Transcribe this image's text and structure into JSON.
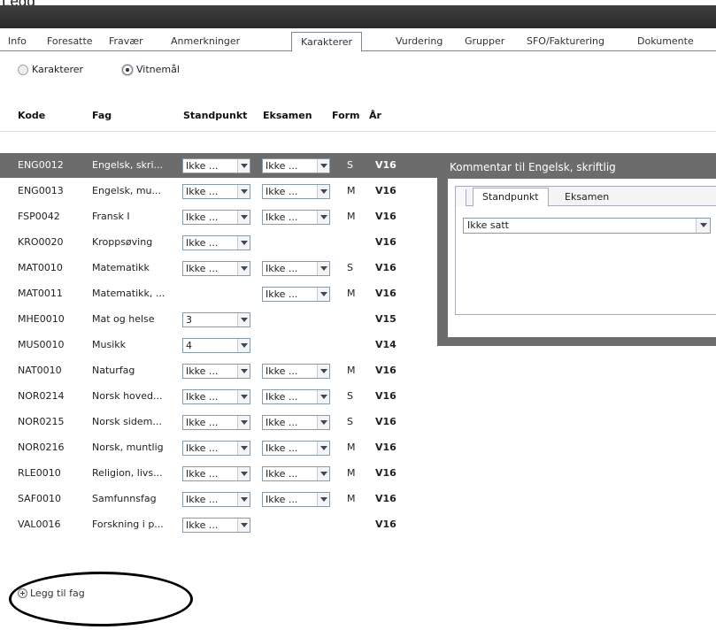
{
  "title_fragment": "Legg",
  "tabs": [
    {
      "label": "Info",
      "active": false
    },
    {
      "label": "Foresatte",
      "active": false
    },
    {
      "label": "Fravær",
      "active": false
    },
    {
      "label": "Anmerkninger",
      "active": false
    },
    {
      "label": "Karakterer",
      "active": true
    },
    {
      "label": "Vurdering",
      "active": false
    },
    {
      "label": "Grupper",
      "active": false
    },
    {
      "label": "SFO/Fakturering",
      "active": false
    },
    {
      "label": "Dokumente",
      "active": false
    }
  ],
  "mode": {
    "options": [
      {
        "label": "Karakterer",
        "checked": false
      },
      {
        "label": "Vitnemål",
        "checked": true
      }
    ]
  },
  "table": {
    "columns": [
      "Kode",
      "Fag",
      "Standpunkt",
      "Eksamen",
      "Form",
      "År"
    ],
    "rows": [
      {
        "kode": "ENG0012",
        "fag": "Engelsk, skri...",
        "standpunkt": "Ikke ...",
        "eksamen": "Ikke ...",
        "form": "S",
        "ar": "V16",
        "selected": true
      },
      {
        "kode": "ENG0013",
        "fag": "Engelsk, mu...",
        "standpunkt": "Ikke ...",
        "eksamen": "Ikke ...",
        "form": "M",
        "ar": "V16"
      },
      {
        "kode": "FSP0042",
        "fag": "Fransk I",
        "standpunkt": "Ikke ...",
        "eksamen": "Ikke ...",
        "form": "M",
        "ar": "V16"
      },
      {
        "kode": "KRO0020",
        "fag": "Kroppsøving",
        "standpunkt": "Ikke ...",
        "eksamen": "",
        "form": "",
        "ar": "V16"
      },
      {
        "kode": "MAT0010",
        "fag": "Matematikk",
        "standpunkt": "Ikke ...",
        "eksamen": "Ikke ...",
        "form": "S",
        "ar": "V16"
      },
      {
        "kode": "MAT0011",
        "fag": "Matematikk, ...",
        "standpunkt": "",
        "eksamen": "Ikke ...",
        "form": "M",
        "ar": "V16"
      },
      {
        "kode": "MHE0010",
        "fag": "Mat og helse",
        "standpunkt": "3",
        "eksamen": "",
        "form": "",
        "ar": "V15"
      },
      {
        "kode": "MUS0010",
        "fag": "Musikk",
        "standpunkt": "4",
        "eksamen": "",
        "form": "",
        "ar": "V14"
      },
      {
        "kode": "NAT0010",
        "fag": "Naturfag",
        "standpunkt": "Ikke ...",
        "eksamen": "Ikke ...",
        "form": "M",
        "ar": "V16"
      },
      {
        "kode": "NOR0214",
        "fag": "Norsk hoved...",
        "standpunkt": "Ikke ...",
        "eksamen": "Ikke ...",
        "form": "S",
        "ar": "V16"
      },
      {
        "kode": "NOR0215",
        "fag": "Norsk sidem...",
        "standpunkt": "Ikke ...",
        "eksamen": "Ikke ...",
        "form": "S",
        "ar": "V16"
      },
      {
        "kode": "NOR0216",
        "fag": "Norsk, muntlig",
        "standpunkt": "Ikke ...",
        "eksamen": "Ikke ...",
        "form": "M",
        "ar": "V16"
      },
      {
        "kode": "RLE0010",
        "fag": "Religion, livs...",
        "standpunkt": "Ikke ...",
        "eksamen": "Ikke ...",
        "form": "M",
        "ar": "V16"
      },
      {
        "kode": "SAF0010",
        "fag": "Samfunnsfag",
        "standpunkt": "Ikke ...",
        "eksamen": "Ikke ...",
        "form": "M",
        "ar": "V16"
      },
      {
        "kode": "VAL0016",
        "fag": "Forskning i p...",
        "standpunkt": "Ikke ...",
        "eksamen": "",
        "form": "",
        "ar": "V16"
      }
    ]
  },
  "comment_panel": {
    "title": "Kommentar til Engelsk, skriftlig",
    "tabs": [
      "Standpunkt",
      "Eksamen"
    ],
    "active_tab": "Standpunkt",
    "select_value": "Ikke satt"
  },
  "add_subject": {
    "label": "Legg til fag",
    "icon": "plus-circle-icon"
  },
  "colors": {
    "selected_row": "#6c6c6c",
    "dark_bar": "#333333",
    "tab_border": "#7e8b94"
  }
}
